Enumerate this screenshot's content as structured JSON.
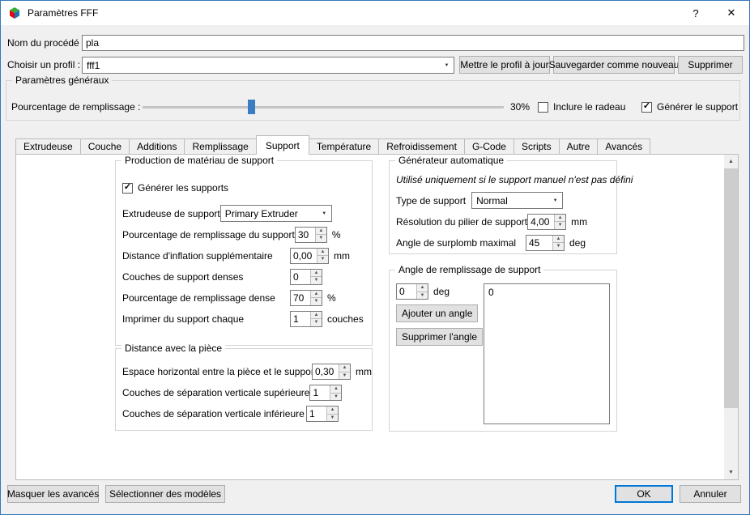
{
  "window": {
    "title": "Paramètres FFF",
    "help": "?",
    "close": "✕"
  },
  "header": {
    "process_label": "Nom du procédé :",
    "process_value": "pla",
    "profile_label": "Choisir un profil :",
    "profile_value": "fff1",
    "update_button": "Mettre le profil à jour",
    "save_new_button": "Sauvegarder comme nouveau",
    "delete_button": "Supprimer"
  },
  "general": {
    "title": "Paramètres généraux",
    "infill_label": "Pourcentage de remplissage :",
    "infill_value": "30%",
    "infill_percent": 30,
    "raft_label": "Inclure le radeau",
    "support_label": "Générer le support"
  },
  "tabs": [
    {
      "label": "Extrudeuse"
    },
    {
      "label": "Couche"
    },
    {
      "label": "Additions"
    },
    {
      "label": "Remplissage"
    },
    {
      "label": "Support"
    },
    {
      "label": "Température"
    },
    {
      "label": "Refroidissement"
    },
    {
      "label": "G-Code"
    },
    {
      "label": "Scripts"
    },
    {
      "label": "Autre"
    },
    {
      "label": "Avancés"
    }
  ],
  "support": {
    "material": {
      "title": "Production de matériau de support",
      "generate_label": "Générer les supports",
      "extruder_label": "Extrudeuse de support",
      "extruder_value": "Primary Extruder",
      "infill_label": "Pourcentage de remplissage du support",
      "infill_value": "30",
      "infill_unit": "%",
      "inflation_label": "Distance d'inflation supplémentaire",
      "inflation_value": "0,00",
      "inflation_unit": "mm",
      "dense_layers_label": "Couches de support denses",
      "dense_layers_value": "0",
      "dense_infill_label": "Pourcentage de remplissage dense",
      "dense_infill_value": "70",
      "dense_infill_unit": "%",
      "every_label": "Imprimer du support chaque",
      "every_value": "1",
      "every_unit": "couches"
    },
    "distance": {
      "title": "Distance avec la pièce",
      "horizontal_label": "Espace horizontal entre la pièce et le support",
      "horizontal_value": "0,30",
      "horizontal_unit": "mm",
      "upper_label": "Couches de séparation verticale supérieure",
      "upper_value": "1",
      "lower_label": "Couches de séparation verticale inférieure",
      "lower_value": "1"
    },
    "auto": {
      "title": "Générateur automatique",
      "note": "Utilisé uniquement si le support manuel n'est pas défini",
      "type_label": "Type de support",
      "type_value": "Normal",
      "pillar_label": "Résolution du pilier de support",
      "pillar_value": "4,00",
      "pillar_unit": "mm",
      "overhang_label": "Angle de surplomb maximal",
      "overhang_value": "45",
      "overhang_unit": "deg"
    },
    "angles": {
      "title": "Angle de remplissage de support",
      "angle_value": "0",
      "angle_unit": "deg",
      "add_button": "Ajouter un angle",
      "remove_button": "Supprimer l'angle",
      "items": [
        "0"
      ]
    }
  },
  "footer": {
    "hide_advanced": "Masquer les avancés",
    "select_models": "Sélectionner des modèles",
    "ok": "OK",
    "cancel": "Annuler"
  },
  "icons": {
    "combo_arrow": "▼",
    "spin_up": "▲",
    "spin_down": "▼",
    "check": "✓",
    "scroll_up": "▲",
    "scroll_down": "▼"
  },
  "colors": {
    "accent": "#0078d7",
    "window_border": "#3577bd",
    "slider_thumb": "#3b7dc4"
  }
}
